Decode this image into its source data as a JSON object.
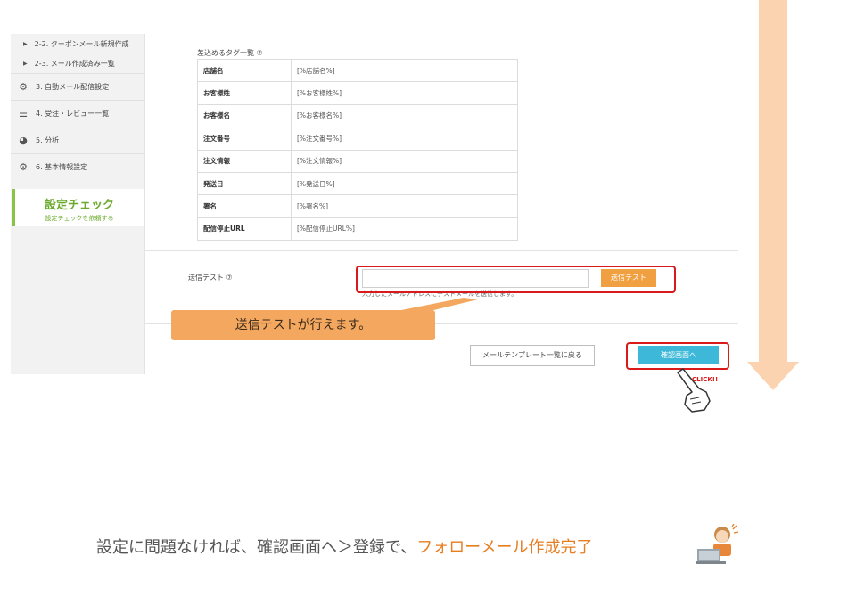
{
  "sidebar": {
    "sub_items": [
      {
        "label": "2-2. クーポンメール新規作成"
      },
      {
        "label": "2-3. メール作成済み一覧"
      }
    ],
    "items": [
      {
        "icon": "gears-icon",
        "label": "3. 自動メール配信設定"
      },
      {
        "icon": "list-icon",
        "label": "4. 受注・レビュー一覧"
      },
      {
        "icon": "pie-chart-icon",
        "label": "5. 分析"
      },
      {
        "icon": "gear-icon",
        "label": "6. 基本情報設定"
      }
    ],
    "check": {
      "title": "設定チェック",
      "subtitle": "設定チェックを依頼する"
    }
  },
  "tags": {
    "header": "差込めるタグ一覧 ⑦",
    "rows": [
      {
        "key": "店舗名",
        "value": "[%店舗名%]"
      },
      {
        "key": "お客様姓",
        "value": "[%お客様姓%]"
      },
      {
        "key": "お客様名",
        "value": "[%お客様名%]"
      },
      {
        "key": "注文番号",
        "value": "[%注文番号%]"
      },
      {
        "key": "注文情報",
        "value": "[%注文情報%]"
      },
      {
        "key": "発送日",
        "value": "[%発送日%]"
      },
      {
        "key": "署名",
        "value": "[%署名%]"
      },
      {
        "key": "配信停止URL",
        "value": "[%配信停止URL%]"
      }
    ]
  },
  "send_test": {
    "label": "送信テスト ⑦",
    "input_value": "",
    "button": "送信テスト",
    "help": "入力したメールアドレスにテストメールを送信します。"
  },
  "footer": {
    "back_button": "メールテンプレート一覧に戻る",
    "confirm_button": "確認画面へ"
  },
  "callout": "送信テストが行えます。",
  "click_label": "CLICK!!",
  "caption": {
    "main": "設定に問題なければ、確認画面へ＞登録で、",
    "highlight": "フォローメール作成完了"
  },
  "colors": {
    "orange": "#f0a040",
    "callout": "#f4a85f",
    "highlight_red": "#d81a1a",
    "confirm_blue": "#3eb8d8",
    "check_green": "#6aaa2a",
    "caption_orange": "#e67e22"
  }
}
